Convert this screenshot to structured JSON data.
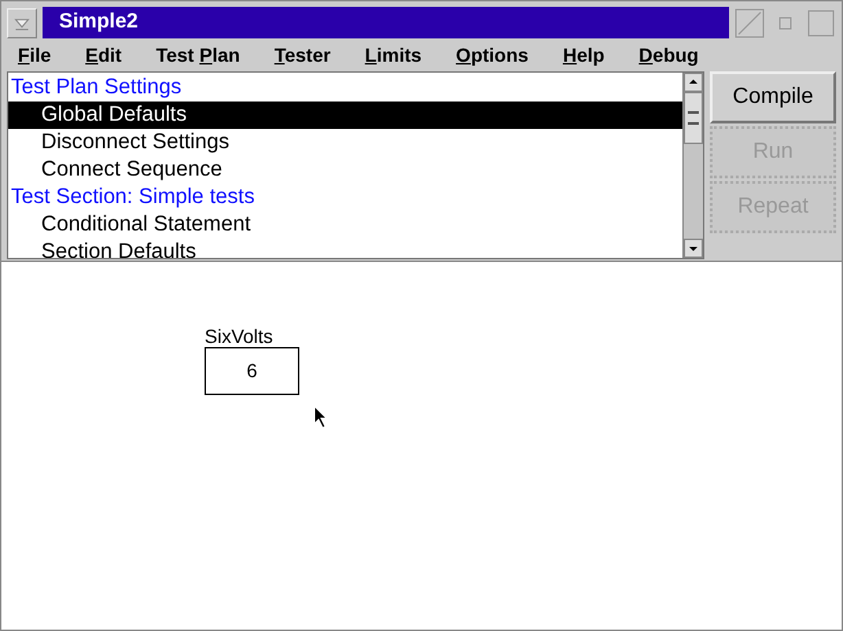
{
  "window": {
    "title": "Simple2"
  },
  "menu": [
    {
      "mnemonic": "F",
      "after": "ile"
    },
    {
      "mnemonic": "E",
      "after": "dit"
    },
    {
      "before": "Test ",
      "mnemonic": "P",
      "after": "lan"
    },
    {
      "mnemonic": "T",
      "after": "ester"
    },
    {
      "mnemonic": "L",
      "after": "imits"
    },
    {
      "mnemonic": "O",
      "after": "ptions"
    },
    {
      "mnemonic": "H",
      "after": "elp"
    },
    {
      "mnemonic": "D",
      "after": "ebug"
    }
  ],
  "tree": [
    {
      "kind": "section",
      "label": "Test Plan Settings",
      "selected": false
    },
    {
      "kind": "item",
      "label": "Global Defaults",
      "selected": true
    },
    {
      "kind": "item",
      "label": "Disconnect Settings",
      "selected": false
    },
    {
      "kind": "item",
      "label": "Connect Sequence",
      "selected": false
    },
    {
      "kind": "section",
      "label": "Test Section: Simple tests",
      "selected": false
    },
    {
      "kind": "item",
      "label": "Conditional Statement",
      "selected": false
    },
    {
      "kind": "item",
      "label": "Section Defaults",
      "selected": false
    }
  ],
  "buttons": [
    {
      "label": "Compile",
      "disabled": false
    },
    {
      "label": "Run",
      "disabled": true
    },
    {
      "label": "Repeat",
      "disabled": true
    }
  ],
  "canvas": {
    "variable": {
      "label": "SixVolts",
      "value": "6"
    }
  }
}
